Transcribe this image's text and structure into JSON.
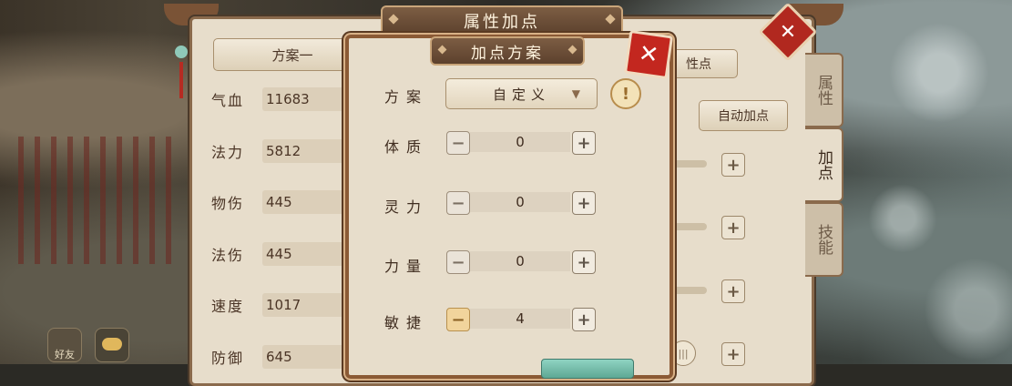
{
  "main_window": {
    "title": "属性加点",
    "plan_tab_1": "方案一",
    "plan_tab_right_partial": "性点",
    "auto_assign_button": "自动加点",
    "stats": [
      {
        "label": "气血",
        "value": "11683"
      },
      {
        "label": "法力",
        "value": "5812"
      },
      {
        "label": "物伤",
        "value": "445"
      },
      {
        "label": "法伤",
        "value": "445"
      },
      {
        "label": "速度",
        "value": "1017"
      },
      {
        "label": "防御",
        "value": "645"
      }
    ],
    "side_tabs": [
      {
        "label": "属性",
        "active": false
      },
      {
        "label": "加点",
        "active": true
      },
      {
        "label": "技能",
        "active": false
      }
    ],
    "close_label": "✕"
  },
  "dialog": {
    "title": "加点方案",
    "close_label": "✕",
    "plan_label": "方案",
    "plan_value": "自定义",
    "warn_symbol": "!",
    "attributes": [
      {
        "label": "体质",
        "value": "0"
      },
      {
        "label": "灵力",
        "value": "0"
      },
      {
        "label": "力量",
        "value": "0"
      },
      {
        "label": "敏捷",
        "value": "4"
      }
    ]
  },
  "hud": {
    "friends_label": "好友"
  },
  "colors": {
    "panel_bg": "#e7ddcb",
    "frame_brown": "#8b5a35",
    "close_red": "#c3271f",
    "confirm_teal": "#5ea894"
  }
}
